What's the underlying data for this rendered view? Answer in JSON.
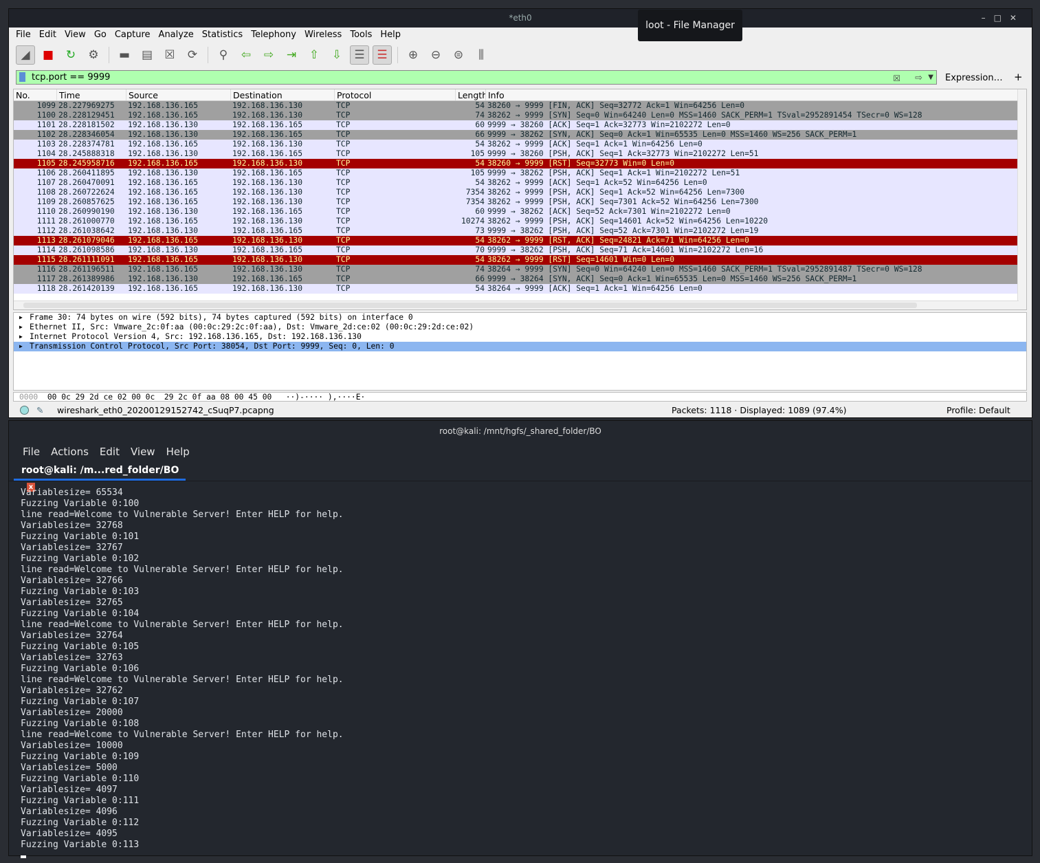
{
  "wireshark": {
    "title": "*eth0",
    "menu": [
      "File",
      "Edit",
      "View",
      "Go",
      "Capture",
      "Analyze",
      "Statistics",
      "Telephony",
      "Wireless",
      "Tools",
      "Help"
    ],
    "toolbar": [
      "shark-fin-icon",
      "stop-icon",
      "restart-icon",
      "options-gear-icon",
      "open-folder-icon",
      "save-file-icon",
      "close-file-icon",
      "reload-icon",
      "find-icon",
      "back-icon",
      "forward-icon",
      "go-to-packet-icon",
      "first-packet-icon",
      "last-packet-icon",
      "autoscroll-icon",
      "colorize-icon",
      "zoom-in-icon",
      "zoom-out-icon",
      "zoom-normal-icon",
      "resize-columns-icon"
    ],
    "filter": "tcp.port == 9999",
    "expression_label": "Expression…",
    "plus_label": "+",
    "columns": [
      "No.",
      "Time",
      "Source",
      "Destination",
      "Protocol",
      "Length",
      "Info"
    ],
    "packets": [
      [
        "1099",
        "28.227969275",
        "192.168.136.165",
        "192.168.136.130",
        "TCP",
        "54",
        "38260 → 9999 [FIN, ACK] Seq=32772 Ack=1 Win=64256 Len=0",
        "gray"
      ],
      [
        "1100",
        "28.228129451",
        "192.168.136.165",
        "192.168.136.130",
        "TCP",
        "74",
        "38262 → 9999 [SYN] Seq=0 Win=64240 Len=0 MSS=1460 SACK_PERM=1 TSval=2952891454 TSecr=0 WS=128",
        "gray"
      ],
      [
        "1101",
        "28.228181502",
        "192.168.136.130",
        "192.168.136.165",
        "TCP",
        "60",
        "9999 → 38260 [ACK] Seq=1 Ack=32773 Win=2102272 Len=0",
        "lav"
      ],
      [
        "1102",
        "28.228346054",
        "192.168.136.130",
        "192.168.136.165",
        "TCP",
        "66",
        "9999 → 38262 [SYN, ACK] Seq=0 Ack=1 Win=65535 Len=0 MSS=1460 WS=256 SACK_PERM=1",
        "gray"
      ],
      [
        "1103",
        "28.228374781",
        "192.168.136.165",
        "192.168.136.130",
        "TCP",
        "54",
        "38262 → 9999 [ACK] Seq=1 Ack=1 Win=64256 Len=0",
        "lav"
      ],
      [
        "1104",
        "28.245888318",
        "192.168.136.130",
        "192.168.136.165",
        "TCP",
        "105",
        "9999 → 38260 [PSH, ACK] Seq=1 Ack=32773 Win=2102272 Len=51",
        "lav"
      ],
      [
        "1105",
        "28.245958716",
        "192.168.136.165",
        "192.168.136.130",
        "TCP",
        "54",
        "38260 → 9999 [RST] Seq=32773 Win=0 Len=0",
        "red"
      ],
      [
        "1106",
        "28.260411895",
        "192.168.136.130",
        "192.168.136.165",
        "TCP",
        "105",
        "9999 → 38262 [PSH, ACK] Seq=1 Ack=1 Win=2102272 Len=51",
        "lav"
      ],
      [
        "1107",
        "28.260470091",
        "192.168.136.165",
        "192.168.136.130",
        "TCP",
        "54",
        "38262 → 9999 [ACK] Seq=1 Ack=52 Win=64256 Len=0",
        "lav"
      ],
      [
        "1108",
        "28.260722624",
        "192.168.136.165",
        "192.168.136.130",
        "TCP",
        "7354",
        "38262 → 9999 [PSH, ACK] Seq=1 Ack=52 Win=64256 Len=7300",
        "lav"
      ],
      [
        "1109",
        "28.260857625",
        "192.168.136.165",
        "192.168.136.130",
        "TCP",
        "7354",
        "38262 → 9999 [PSH, ACK] Seq=7301 Ack=52 Win=64256 Len=7300",
        "lav"
      ],
      [
        "1110",
        "28.260990190",
        "192.168.136.130",
        "192.168.136.165",
        "TCP",
        "60",
        "9999 → 38262 [ACK] Seq=52 Ack=7301 Win=2102272 Len=0",
        "lav"
      ],
      [
        "1111",
        "28.261000770",
        "192.168.136.165",
        "192.168.136.130",
        "TCP",
        "10274",
        "38262 → 9999 [PSH, ACK] Seq=14601 Ack=52 Win=64256 Len=10220",
        "lav"
      ],
      [
        "1112",
        "28.261038642",
        "192.168.136.130",
        "192.168.136.165",
        "TCP",
        "73",
        "9999 → 38262 [PSH, ACK] Seq=52 Ack=7301 Win=2102272 Len=19",
        "lav"
      ],
      [
        "1113",
        "28.261079046",
        "192.168.136.165",
        "192.168.136.130",
        "TCP",
        "54",
        "38262 → 9999 [RST, ACK] Seq=24821 Ack=71 Win=64256 Len=0",
        "red"
      ],
      [
        "1114",
        "28.261098586",
        "192.168.136.130",
        "192.168.136.165",
        "TCP",
        "70",
        "9999 → 38262 [PSH, ACK] Seq=71 Ack=14601 Win=2102272 Len=16",
        "lav"
      ],
      [
        "1115",
        "28.261111091",
        "192.168.136.165",
        "192.168.136.130",
        "TCP",
        "54",
        "38262 → 9999 [RST] Seq=14601 Win=0 Len=0",
        "red"
      ],
      [
        "1116",
        "28.261196511",
        "192.168.136.165",
        "192.168.136.130",
        "TCP",
        "74",
        "38264 → 9999 [SYN] Seq=0 Win=64240 Len=0 MSS=1460 SACK_PERM=1 TSval=2952891487 TSecr=0 WS=128",
        "gray"
      ],
      [
        "1117",
        "28.261389986",
        "192.168.136.130",
        "192.168.136.165",
        "TCP",
        "66",
        "9999 → 38264 [SYN, ACK] Seq=0 Ack=1 Win=65535 Len=0 MSS=1460 WS=256 SACK_PERM=1",
        "gray"
      ],
      [
        "1118",
        "28.261420139",
        "192.168.136.165",
        "192.168.136.130",
        "TCP",
        "54",
        "38264 → 9999 [ACK] Seq=1 Ack=1 Win=64256 Len=0",
        "lav"
      ]
    ],
    "details": [
      "Frame 30: 74 bytes on wire (592 bits), 74 bytes captured (592 bits) on interface 0",
      "Ethernet II, Src: Vmware_2c:0f:aa (00:0c:29:2c:0f:aa), Dst: Vmware_2d:ce:02 (00:0c:29:2d:ce:02)",
      "Internet Protocol Version 4, Src: 192.168.136.165, Dst: 192.168.136.130",
      "Transmission Control Protocol, Src Port: 38054, Dst Port: 9999, Seq: 0, Len: 0"
    ],
    "hex": {
      "offset": "0000",
      "bytes": "00 0c 29 2d ce 02 00 0c  29 2c 0f aa 08 00 45 00",
      "ascii": "··)-···· ),····E·"
    },
    "status": {
      "file": "wireshark_eth0_20200129152742_cSuqP7.pcapng",
      "packets": "Packets: 1118 · Displayed: 1089 (97.4%)",
      "profile": "Profile: Default"
    },
    "colors": {
      "syn_fin": "#a0a0a0",
      "tcp": "#e7e6ff",
      "rst": "#a40000",
      "rst_text": "#fffc9c",
      "filter_ok": "#afffaf"
    }
  },
  "tooltip": "loot - File Manager",
  "terminal": {
    "title": "root@kali: /mnt/hgfs/_shared_folder/BO",
    "menu": [
      "File",
      "Actions",
      "Edit",
      "View",
      "Help"
    ],
    "tab": "root@kali: /m...red_folder/BO",
    "tab_close": "x",
    "lines": [
      "Variablesize= 65534",
      "Fuzzing Variable 0:100",
      "line read=Welcome to Vulnerable Server! Enter HELP for help.",
      "Variablesize= 32768",
      "Fuzzing Variable 0:101",
      "Variablesize= 32767",
      "Fuzzing Variable 0:102",
      "line read=Welcome to Vulnerable Server! Enter HELP for help.",
      "Variablesize= 32766",
      "Fuzzing Variable 0:103",
      "Variablesize= 32765",
      "Fuzzing Variable 0:104",
      "line read=Welcome to Vulnerable Server! Enter HELP for help.",
      "Variablesize= 32764",
      "Fuzzing Variable 0:105",
      "Variablesize= 32763",
      "Fuzzing Variable 0:106",
      "line read=Welcome to Vulnerable Server! Enter HELP for help.",
      "Variablesize= 32762",
      "Fuzzing Variable 0:107",
      "Variablesize= 20000",
      "Fuzzing Variable 0:108",
      "line read=Welcome to Vulnerable Server! Enter HELP for help.",
      "Variablesize= 10000",
      "Fuzzing Variable 0:109",
      "Variablesize= 5000",
      "Fuzzing Variable 0:110",
      "Variablesize= 4097",
      "Fuzzing Variable 0:111",
      "Variablesize= 4096",
      "Fuzzing Variable 0:112",
      "Variablesize= 4095",
      "Fuzzing Variable 0:113"
    ]
  }
}
